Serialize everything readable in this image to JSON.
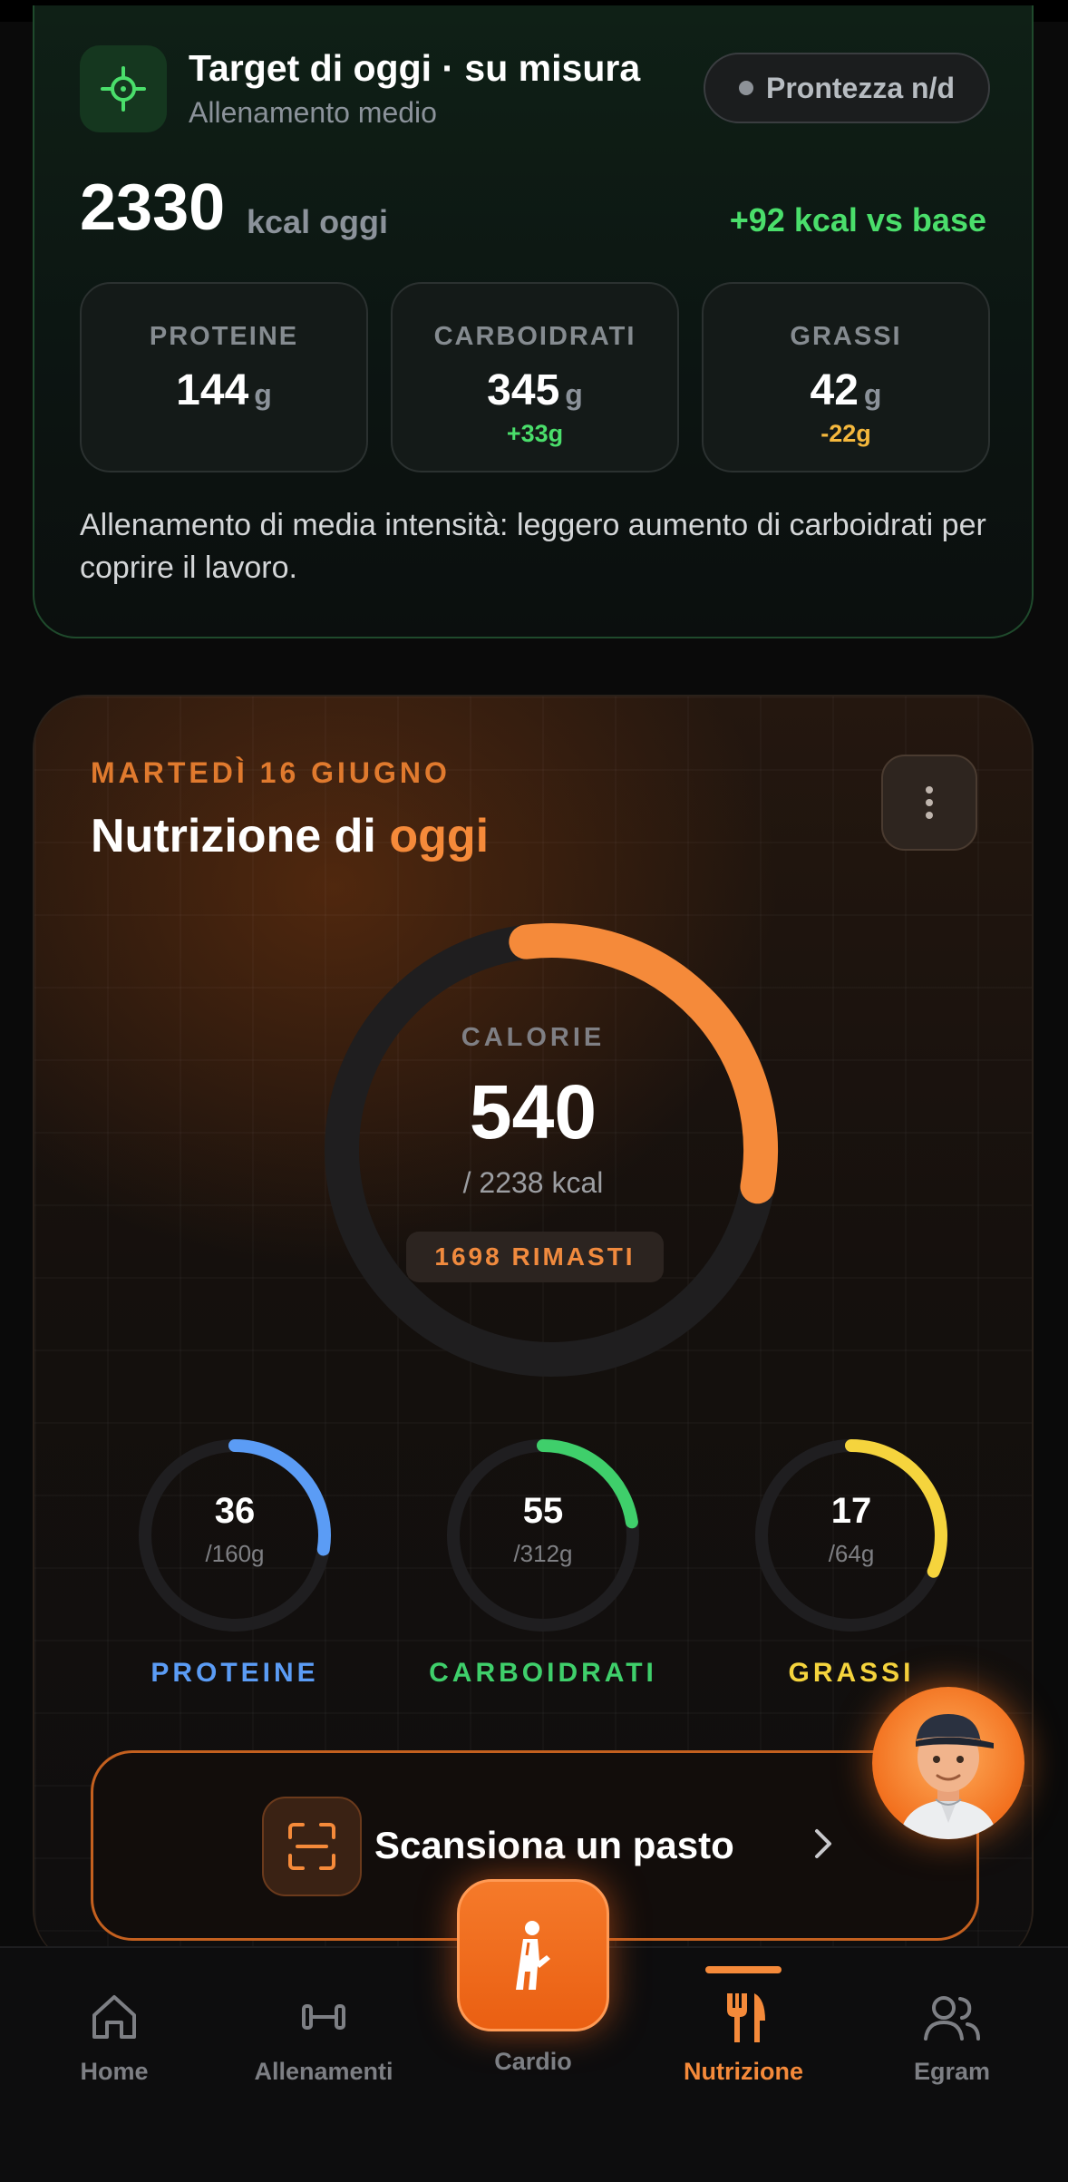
{
  "target": {
    "title": "Target di oggi · su misura",
    "subtitle": "Allenamento medio",
    "readiness": "Prontezza n/d",
    "kcal": "2330",
    "kcal_unit": "kcal oggi",
    "kcal_delta": "+92 kcal vs base",
    "macros": [
      {
        "label": "PROTEINE",
        "value": "144",
        "unit": "g",
        "delta": ""
      },
      {
        "label": "CARBOIDRATI",
        "value": "345",
        "unit": "g",
        "delta": "+33g"
      },
      {
        "label": "GRASSI",
        "value": "42",
        "unit": "g",
        "delta": "-22g"
      }
    ],
    "note": "Allenamento di media intensità: leggero aumento di carboidrati per coprire il lavoro.",
    "colors": {
      "positive": "#4ade6b",
      "negative": "#f5b83d",
      "accent": "#4ade6b"
    }
  },
  "nutrition": {
    "date": "MARTEDÌ 16 GIUGNO",
    "title_prefix": "Nutrizione di",
    "title_highlight": "oggi",
    "calories": {
      "label": "CALORIE",
      "consumed": "540",
      "target_text": "/ 2238 kcal",
      "remaining": "1698 RIMASTI",
      "consumed_num": 540,
      "target_num": 2238
    },
    "macros": [
      {
        "label": "PROTEINE",
        "value": "36",
        "target": "/160g",
        "value_num": 36,
        "target_num": 160,
        "color": "#5b9cf5"
      },
      {
        "label": "CARBOIDRATI",
        "value": "55",
        "target": "/312g",
        "value_num": 55,
        "target_num": 312,
        "color": "#3fcf6b"
      },
      {
        "label": "GRASSI",
        "value": "17",
        "target": "/64g",
        "value_num": 17,
        "target_num": 64,
        "color": "#f5d43d"
      }
    ],
    "accent": "#f58a3a",
    "scan_label": "Scansiona un pasto"
  },
  "nav": {
    "items": [
      {
        "label": "Home",
        "icon": "home-icon"
      },
      {
        "label": "Allenamenti",
        "icon": "dumbbell-icon"
      },
      {
        "label": "Cardio",
        "icon": "runner-icon"
      },
      {
        "label": "Nutrizione",
        "icon": "fork-knife-icon"
      },
      {
        "label": "Egram",
        "icon": "users-icon"
      }
    ],
    "active": "Nutrizione"
  }
}
